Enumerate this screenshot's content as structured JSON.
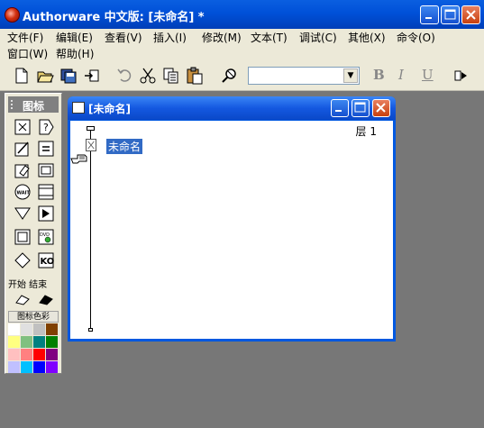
{
  "app": {
    "title": "Authorware 中文版: [未命名] *"
  },
  "menubar": {
    "items": [
      {
        "label": "文件(F)"
      },
      {
        "label": "编辑(E)"
      },
      {
        "label": "查看(V)"
      },
      {
        "label": "插入(I)"
      },
      {
        "label": "修改(M)"
      },
      {
        "label": "文本(T)"
      },
      {
        "label": "调试(C)"
      },
      {
        "label": "其他(X)"
      },
      {
        "label": "命令(O)"
      },
      {
        "label": "窗口(W)"
      },
      {
        "label": "帮助(H)"
      }
    ]
  },
  "toolbar": {
    "font_value": "",
    "bold": "B",
    "italic": "I",
    "underline": "U"
  },
  "palette": {
    "title": "图标",
    "start_end": "开始 结束",
    "color_label": "图标色彩",
    "icons": [
      "display-icon",
      "interaction-icon",
      "calculation-icon",
      "framework-icon",
      "erase-icon",
      "motion-icon",
      "wait-icon",
      "navigate-icon",
      "decision-icon",
      "digital-movie-icon",
      "map-icon",
      "dvd-video-icon",
      "sound-icon",
      "knowledge-object-icon"
    ],
    "swatches": [
      "#ffffff",
      "#e0e0e0",
      "#c0c0c0",
      "#804000",
      "#ffff80",
      "#80c080",
      "#008080",
      "#008000",
      "#ffc0c0",
      "#ff8080",
      "#ff0000",
      "#800080",
      "#c0c0ff",
      "#00c0ff",
      "#0000ff",
      "#8000ff"
    ]
  },
  "child_window": {
    "title": "[未命名]",
    "layer": "层 1",
    "icon_label": "未命名"
  }
}
